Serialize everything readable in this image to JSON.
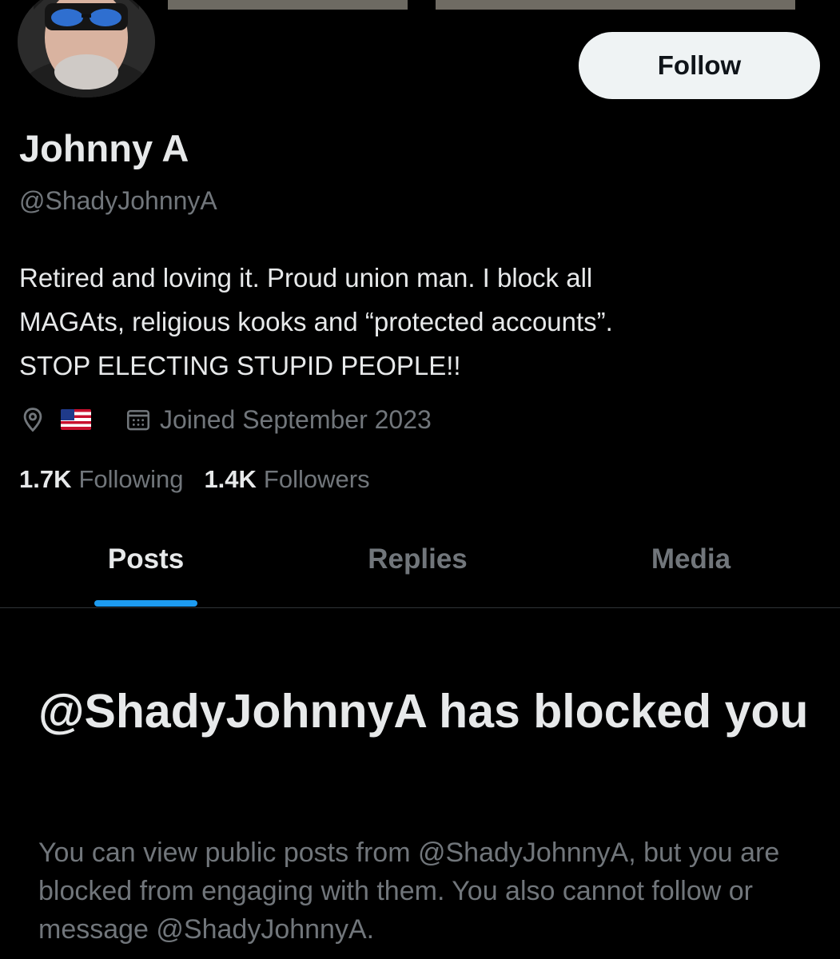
{
  "profile": {
    "display_name": "Johnny A",
    "handle": "@ShadyJohnnyA",
    "bio_lines": [
      "Retired and loving it. Proud union man. I block all",
      "MAGAts, religious kooks and “protected accounts”.",
      "STOP ELECTING STUPID PEOPLE!!"
    ],
    "joined": "Joined September 2023",
    "location_icon": "location-pin-icon",
    "location_flag": "us-flag",
    "calendar_icon": "calendar-icon"
  },
  "actions": {
    "follow_label": "Follow"
  },
  "stats": {
    "following_count": "1.7K",
    "following_label": "Following",
    "followers_count": "1.4K",
    "followers_label": "Followers"
  },
  "tabs": [
    {
      "label": "Posts",
      "active": true
    },
    {
      "label": "Replies",
      "active": false
    },
    {
      "label": "Media",
      "active": false
    }
  ],
  "blocked_notice": {
    "title": "@ShadyJohnnyA has blocked you",
    "description": "You can view public posts from @ShadyJohnnyA, but you are blocked from engaging with them. You also cannot follow or message @ShadyJohnnyA."
  },
  "colors": {
    "background": "#000000",
    "primary_text": "#e7e9ea",
    "secondary_text": "#71767b",
    "accent": "#1d9bf0",
    "follow_button_bg": "#eff3f4",
    "divider": "#2f3336"
  }
}
